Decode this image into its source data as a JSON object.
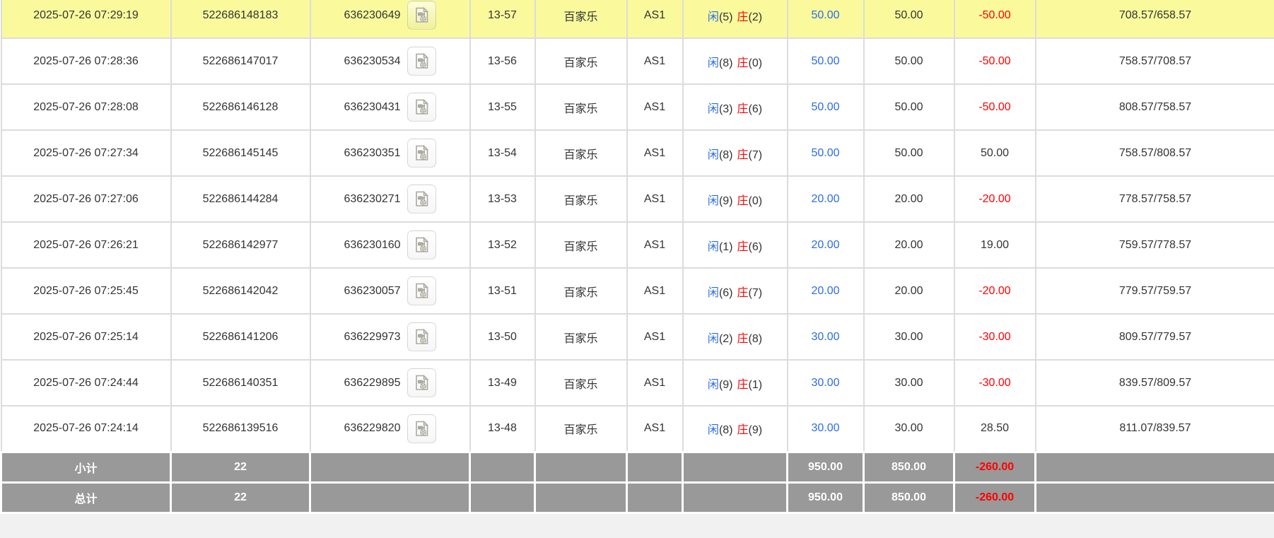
{
  "labels": {
    "player": "闲",
    "banker": "庄",
    "subtotal": "小计",
    "grand_total": "总计",
    "game_name": "百家乐",
    "table_code": "AS1"
  },
  "colors": {
    "accent_blue": "#2b6ce8",
    "loss_red": "#ff0000",
    "highlight_yellow": "#fafa9d",
    "summary_gray": "#999999",
    "border_gray": "#dcdcdc"
  },
  "icons": {
    "round_cell_icon": "video-record-file-icon"
  },
  "rows": [
    {
      "time": "2025-07-26 07:29:19",
      "bet_id": "522686148183",
      "round_id": "636230649",
      "session": "13-57",
      "game": "百家乐",
      "table": "AS1",
      "player_score": "(5)",
      "banker_score": "(2)",
      "bet": "50.00",
      "valid": "50.00",
      "win_loss": "-50.00",
      "balance": "708.57/658.57",
      "highlight": true
    },
    {
      "time": "2025-07-26 07:28:36",
      "bet_id": "522686147017",
      "round_id": "636230534",
      "session": "13-56",
      "game": "百家乐",
      "table": "AS1",
      "player_score": "(8)",
      "banker_score": "(0)",
      "bet": "50.00",
      "valid": "50.00",
      "win_loss": "-50.00",
      "balance": "758.57/708.57",
      "highlight": false
    },
    {
      "time": "2025-07-26 07:28:08",
      "bet_id": "522686146128",
      "round_id": "636230431",
      "session": "13-55",
      "game": "百家乐",
      "table": "AS1",
      "player_score": "(3)",
      "banker_score": "(6)",
      "bet": "50.00",
      "valid": "50.00",
      "win_loss": "-50.00",
      "balance": "808.57/758.57",
      "highlight": false
    },
    {
      "time": "2025-07-26 07:27:34",
      "bet_id": "522686145145",
      "round_id": "636230351",
      "session": "13-54",
      "game": "百家乐",
      "table": "AS1",
      "player_score": "(8)",
      "banker_score": "(7)",
      "bet": "50.00",
      "valid": "50.00",
      "win_loss": "50.00",
      "balance": "758.57/808.57",
      "highlight": false
    },
    {
      "time": "2025-07-26 07:27:06",
      "bet_id": "522686144284",
      "round_id": "636230271",
      "session": "13-53",
      "game": "百家乐",
      "table": "AS1",
      "player_score": "(9)",
      "banker_score": "(0)",
      "bet": "20.00",
      "valid": "20.00",
      "win_loss": "-20.00",
      "balance": "778.57/758.57",
      "highlight": false
    },
    {
      "time": "2025-07-26 07:26:21",
      "bet_id": "522686142977",
      "round_id": "636230160",
      "session": "13-52",
      "game": "百家乐",
      "table": "AS1",
      "player_score": "(1)",
      "banker_score": "(6)",
      "bet": "20.00",
      "valid": "20.00",
      "win_loss": "19.00",
      "balance": "759.57/778.57",
      "highlight": false
    },
    {
      "time": "2025-07-26 07:25:45",
      "bet_id": "522686142042",
      "round_id": "636230057",
      "session": "13-51",
      "game": "百家乐",
      "table": "AS1",
      "player_score": "(6)",
      "banker_score": "(7)",
      "bet": "20.00",
      "valid": "20.00",
      "win_loss": "-20.00",
      "balance": "779.57/759.57",
      "highlight": false
    },
    {
      "time": "2025-07-26 07:25:14",
      "bet_id": "522686141206",
      "round_id": "636229973",
      "session": "13-50",
      "game": "百家乐",
      "table": "AS1",
      "player_score": "(2)",
      "banker_score": "(8)",
      "bet": "30.00",
      "valid": "30.00",
      "win_loss": "-30.00",
      "balance": "809.57/779.57",
      "highlight": false
    },
    {
      "time": "2025-07-26 07:24:44",
      "bet_id": "522686140351",
      "round_id": "636229895",
      "session": "13-49",
      "game": "百家乐",
      "table": "AS1",
      "player_score": "(9)",
      "banker_score": "(1)",
      "bet": "30.00",
      "valid": "30.00",
      "win_loss": "-30.00",
      "balance": "839.57/809.57",
      "highlight": false
    },
    {
      "time": "2025-07-26 07:24:14",
      "bet_id": "522686139516",
      "round_id": "636229820",
      "session": "13-48",
      "game": "百家乐",
      "table": "AS1",
      "player_score": "(8)",
      "banker_score": "(9)",
      "bet": "30.00",
      "valid": "30.00",
      "win_loss": "28.50",
      "balance": "811.07/839.57",
      "highlight": false
    }
  ],
  "summary": {
    "subtotal": {
      "count": "22",
      "bet": "950.00",
      "valid": "850.00",
      "win_loss": "-260.00"
    },
    "total": {
      "count": "22",
      "bet": "950.00",
      "valid": "850.00",
      "win_loss": "-260.00"
    }
  }
}
